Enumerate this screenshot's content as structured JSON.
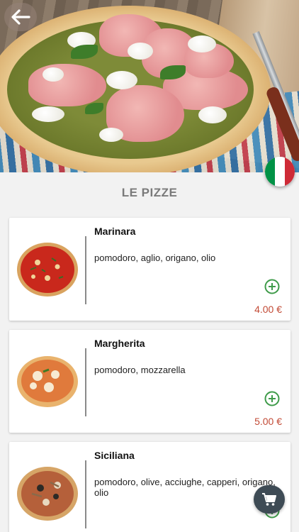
{
  "header": {
    "back_icon": "arrow-left-icon",
    "language_flag": "italy-flag-icon",
    "flag_colors": [
      "#009246",
      "#ffffff",
      "#ce2b37"
    ]
  },
  "section": {
    "title": "LE PIZZE"
  },
  "menu": {
    "items": [
      {
        "name": "Marinara",
        "description": "pomodoro, aglio, origano, olio",
        "price": "4.00 €"
      },
      {
        "name": "Margherita",
        "description": "pomodoro, mozzarella",
        "price": "5.00 €"
      },
      {
        "name": "Siciliana",
        "description": "pomodoro, olive, acciughe, capperi, origano, olio",
        "price": ""
      }
    ]
  },
  "colors": {
    "price": "#c24a35",
    "add": "#3f9b4a",
    "fab": "#3e4b55"
  },
  "cart": {
    "icon": "shopping-cart-icon"
  }
}
